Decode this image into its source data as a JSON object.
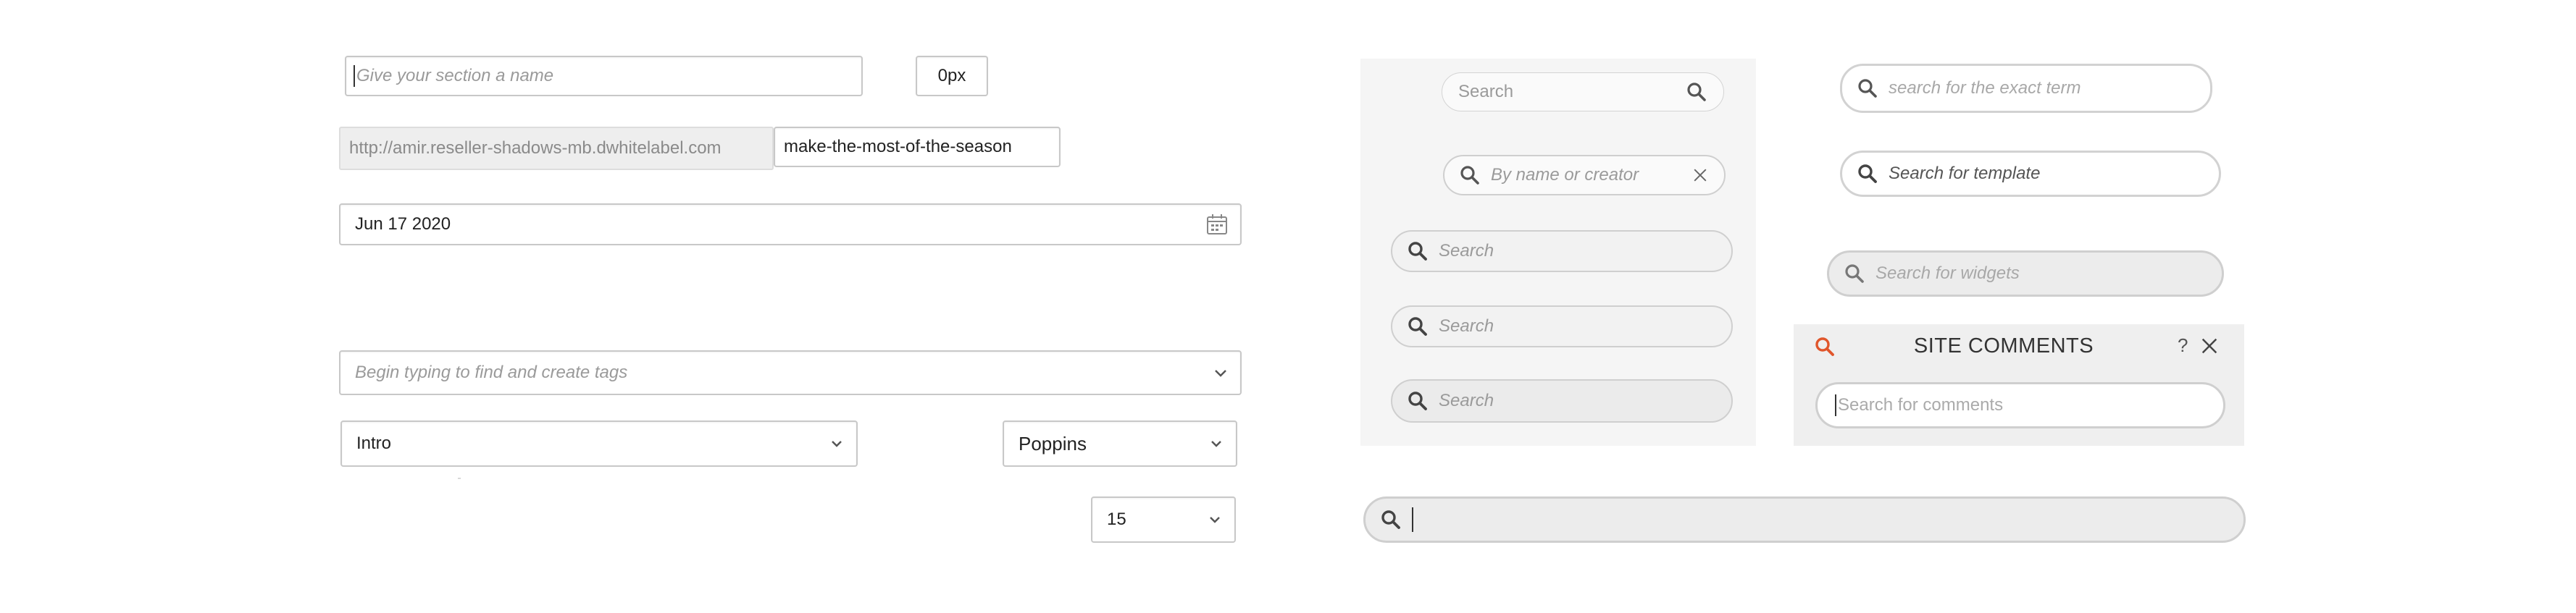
{
  "left": {
    "section_name_placeholder": "Give your section a name",
    "px_value": "0px",
    "url_prefix": "http://amir.reseller-shadows-mb.dwhitelabel.com",
    "slug_value": "make-the-most-of-the-season",
    "date_value": "Jun 17 2020",
    "tags_placeholder": "Begin typing to find and create tags",
    "section_select_value": "Intro",
    "font_select_value": "Poppins",
    "size_select_value": "15"
  },
  "middle": {
    "search_small_placeholder": "Search",
    "creator_placeholder": "By name or creator",
    "search_1": "Search",
    "search_2": "Search",
    "search_3": "Search"
  },
  "right": {
    "exact_term_placeholder": "search for the exact term",
    "template_placeholder": "Search for template",
    "widgets_placeholder": "Search for widgets",
    "site_comments_title": "SITE COMMENTS",
    "help_label": "?",
    "comments_placeholder": "Search for comments"
  },
  "icons": {
    "search": "search-icon",
    "close": "close-icon",
    "calendar": "calendar-icon",
    "chevron": "chevron-down-icon"
  },
  "colors": {
    "accent_search": "#e0562b",
    "panel_bg": "#f5f5f5",
    "field_border": "#c8c8c8"
  }
}
